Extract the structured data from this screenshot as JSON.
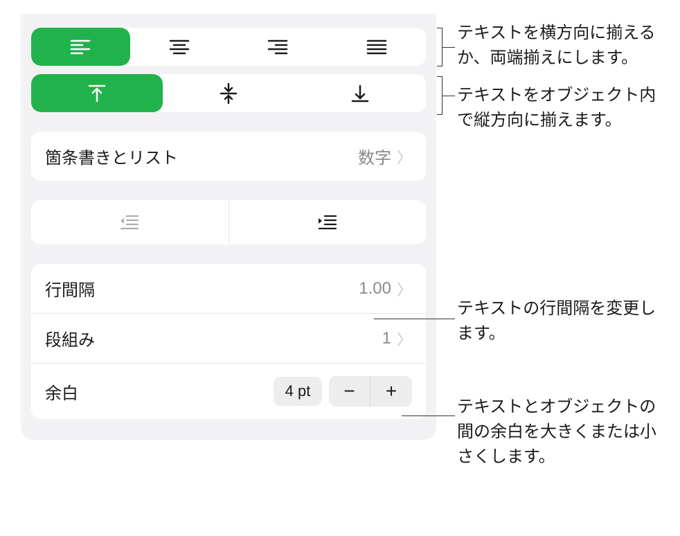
{
  "callouts": {
    "horizontal_align": "テキストを横方向に揃えるか、両端揃えにします。",
    "vertical_align": "テキストをオブジェクト内で縦方向に揃えます。",
    "line_spacing": "テキストの行間隔を変更します。",
    "margin": "テキストとオブジェクトの間の余白を大きくまたは小さくします。"
  },
  "bullets": {
    "label": "箇条書きとリスト",
    "value": "数字"
  },
  "line_spacing": {
    "label": "行間隔",
    "value": "1.00"
  },
  "columns": {
    "label": "段組み",
    "value": "1"
  },
  "margins": {
    "label": "余白",
    "value": "4 pt",
    "minus": "−",
    "plus": "+"
  }
}
